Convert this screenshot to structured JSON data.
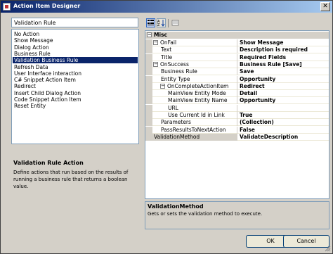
{
  "window": {
    "title": "Action Item Designer",
    "close_label": "✕"
  },
  "combo": {
    "value": "Validation Rule"
  },
  "actions": [
    "No Action",
    "Show Message",
    "Dialog Action",
    "Business Rule",
    "Validation Business Rule",
    "Refresh Data",
    "User Interface interaction",
    "C# Snippet Action Item",
    "Redirect",
    "Insert Child Dialog Action",
    "Code Snippet Action Item",
    "Reset Entity"
  ],
  "selected_action_index": 4,
  "description": {
    "title": "Validation Rule Action",
    "text": "Define actions that run based on the results of running a business rule that returns a boolean value."
  },
  "toolbar": {
    "categorized_icon": "categorized-icon",
    "alphabetical_icon": "alphabetical-icon",
    "property_pages_icon": "property-pages-icon"
  },
  "property_grid": {
    "category": "Misc",
    "rows": [
      {
        "name": "OnFail",
        "value": "Show Message",
        "indent": 0,
        "expander": "−"
      },
      {
        "name": "Text",
        "value": "Description is required",
        "indent": 1,
        "expander": ""
      },
      {
        "name": "Title",
        "value": "Required Fields",
        "indent": 1,
        "expander": ""
      },
      {
        "name": "OnSuccess",
        "value": "Business Rule [Save]",
        "indent": 0,
        "expander": "−"
      },
      {
        "name": "Business Rule",
        "value": "Save",
        "indent": 1,
        "expander": ""
      },
      {
        "name": "Entity Type",
        "value": "Opportunity",
        "indent": 1,
        "expander": ""
      },
      {
        "name": "OnCompleteActionItem",
        "value": "Redirect",
        "indent": 1,
        "expander": "−"
      },
      {
        "name": "MainView Entity Mode",
        "value": "Detail",
        "indent": 2,
        "expander": ""
      },
      {
        "name": "MainView Entity Name",
        "value": "Opportunity",
        "indent": 2,
        "expander": ""
      },
      {
        "name": "URL",
        "value": "",
        "indent": 2,
        "expander": ""
      },
      {
        "name": "Use Current Id in Link",
        "value": "True",
        "indent": 2,
        "expander": ""
      },
      {
        "name": "Parameters",
        "value": "(Collection)",
        "indent": 1,
        "expander": ""
      },
      {
        "name": "PassResultsToNextAction",
        "value": "False",
        "indent": 1,
        "expander": ""
      },
      {
        "name": "ValidationMethod",
        "value": "ValidateDescription",
        "indent": 0,
        "expander": ""
      }
    ],
    "selected_row": 13
  },
  "help": {
    "title": "ValidationMethod",
    "text": "Gets or sets the validation method to execute."
  },
  "buttons": {
    "ok": "OK",
    "cancel": "Cancel"
  }
}
